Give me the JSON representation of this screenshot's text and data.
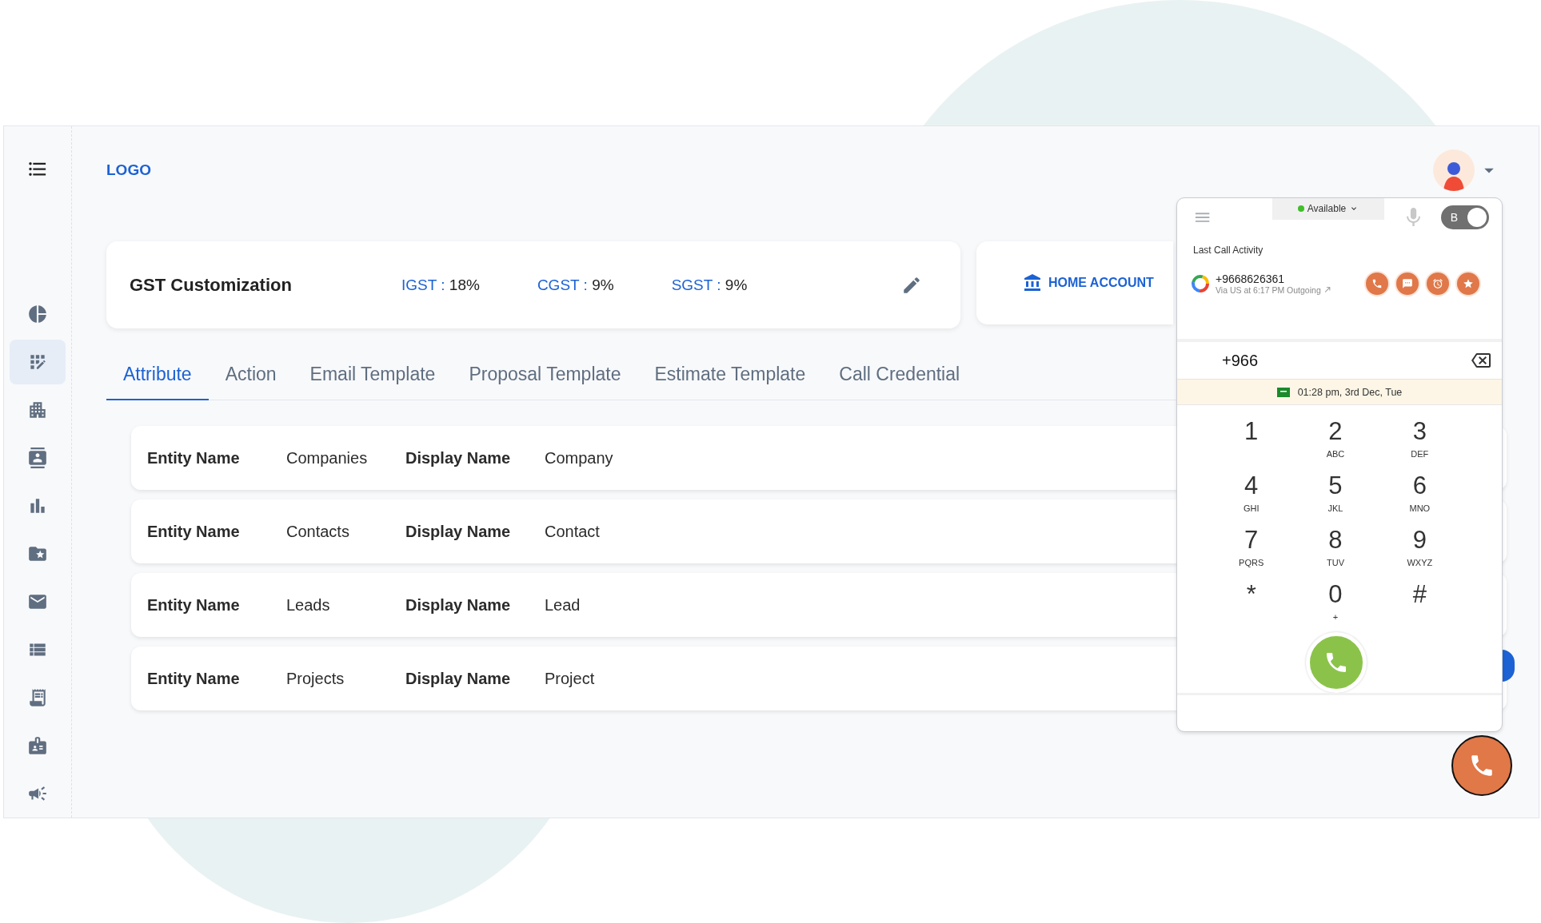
{
  "header": {
    "logo": "LOGO"
  },
  "sidebar": {
    "items": [
      {
        "selected": false
      },
      {
        "selected": true
      },
      {
        "selected": false
      },
      {
        "selected": false
      },
      {
        "selected": false
      },
      {
        "selected": false
      },
      {
        "selected": false
      },
      {
        "selected": false
      },
      {
        "selected": false
      },
      {
        "selected": false
      },
      {
        "selected": false
      }
    ]
  },
  "gst_card": {
    "title": "GST Customization",
    "taxes": [
      {
        "label": "IGST :",
        "value": "18%"
      },
      {
        "label": "CGST :",
        "value": "9%"
      },
      {
        "label": "SGST :",
        "value": "9%"
      }
    ]
  },
  "home_account": {
    "label": "HOME ACCOUNT"
  },
  "tabs": [
    {
      "label": "Attribute",
      "selected": true
    },
    {
      "label": "Action",
      "selected": false
    },
    {
      "label": "Email Template",
      "selected": false
    },
    {
      "label": "Proposal Template",
      "selected": false
    },
    {
      "label": "Estimate Template",
      "selected": false
    },
    {
      "label": "Call Credential",
      "selected": false
    }
  ],
  "rows": [
    {
      "entity_label": "Entity Name",
      "entity_value": "Companies",
      "display_label": "Display Name",
      "display_value": "Company"
    },
    {
      "entity_label": "Entity Name",
      "entity_value": "Contacts",
      "display_label": "Display Name",
      "display_value": "Contact"
    },
    {
      "entity_label": "Entity Name",
      "entity_value": "Leads",
      "display_label": "Display Name",
      "display_value": "Lead"
    },
    {
      "entity_label": "Entity Name",
      "entity_value": "Projects",
      "display_label": "Display Name",
      "display_value": "Project"
    }
  ],
  "dialer": {
    "status": "Available",
    "toggle": {
      "label": "B",
      "on": true
    },
    "last_call_title": "Last Call Activity",
    "last_call": {
      "number": "+9668626361",
      "detail": "Via US at 6:17 PM Outgoing"
    },
    "input_value": "+966",
    "time": "01:28 pm, 3rd Dec, Tue",
    "keys": [
      {
        "digit": "1"
      },
      {
        "digit": "2",
        "letters": "ABC"
      },
      {
        "digit": "3",
        "letters": "DEF"
      },
      {
        "digit": "4",
        "letters": "GHI"
      },
      {
        "digit": "5",
        "letters": "JKL"
      },
      {
        "digit": "6",
        "letters": "MNO"
      },
      {
        "digit": "7",
        "letters": "PQRS"
      },
      {
        "digit": "8",
        "letters": "TUV"
      },
      {
        "digit": "9",
        "letters": "WXYZ"
      },
      {
        "digit": "*"
      },
      {
        "digit": "0",
        "letters": "+"
      },
      {
        "digit": "#"
      }
    ]
  }
}
